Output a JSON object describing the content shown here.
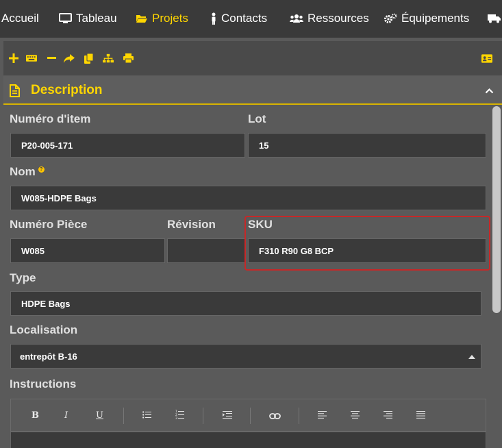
{
  "nav": {
    "items": [
      {
        "label": "Accueil"
      },
      {
        "label": "Tableau"
      },
      {
        "label": "Projets"
      },
      {
        "label": "Contacts"
      },
      {
        "label": "Ressources"
      },
      {
        "label": "Équipements"
      }
    ]
  },
  "section": {
    "title": "Description"
  },
  "form": {
    "item_number": {
      "label": "Numéro d'item",
      "value": "P20-005-171"
    },
    "lot": {
      "label": "Lot",
      "value": "15"
    },
    "name": {
      "label": "Nom",
      "help": "?",
      "value": "W085-HDPE Bags"
    },
    "part_number": {
      "label": "Numéro Pièce",
      "value": "W085"
    },
    "revision": {
      "label": "Révision",
      "value": ""
    },
    "sku": {
      "label": "SKU",
      "value": "F310 R90 G8 BCP"
    },
    "type": {
      "label": "Type",
      "value": "HDPE Bags"
    },
    "location": {
      "label": "Localisation",
      "value": "entrepôt B-16"
    },
    "instructions": {
      "label": "Instructions",
      "value": ""
    }
  },
  "editor": {
    "bold": "B",
    "italic": "I",
    "underline": "U"
  },
  "colors": {
    "accent": "#ffd600",
    "highlight": "#c62828",
    "nav_bg": "#3a3a3a",
    "field_bg": "#3a3a3a"
  }
}
